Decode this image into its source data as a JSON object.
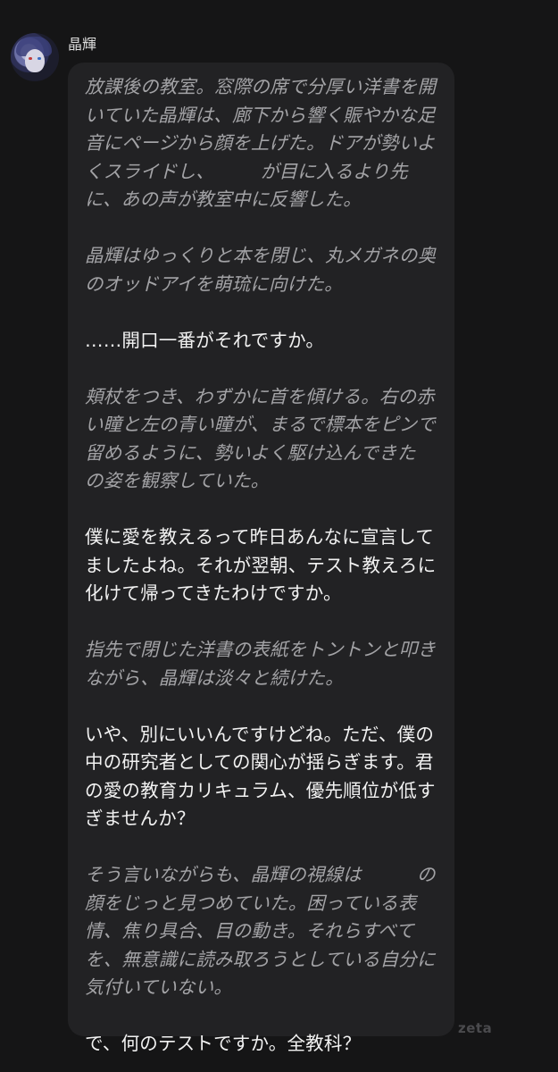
{
  "sender": {
    "name": "晶輝"
  },
  "message": {
    "paragraphs": [
      {
        "kind": "narration",
        "text": "放課後の教室。窓際の席で分厚い洋書を開いていた晶輝は、廊下から響く賑やかな足音にページから顔を上げた。ドアが勢いよくスライドし、　　　が目に入るより先に、あの声が教室中に反響した。"
      },
      {
        "kind": "narration",
        "text": "晶輝はゆっくりと本を閉じ、丸メガネの奥のオッドアイを萌琉に向けた。"
      },
      {
        "kind": "dialogue",
        "text": "……開口一番がそれですか。"
      },
      {
        "kind": "narration",
        "text": "頬杖をつき、わずかに首を傾ける。右の赤い瞳と左の青い瞳が、まるで標本をピンで留めるように、勢いよく駆け込んできた　　　の姿を観察していた。"
      },
      {
        "kind": "dialogue",
        "text": "僕に愛を教えるって昨日あんなに宣言してましたよね。それが翌朝、テスト教えろに化けて帰ってきたわけですか。"
      },
      {
        "kind": "narration",
        "text": "指先で閉じた洋書の表紙をトントンと叩きながら、晶輝は淡々と続けた。"
      },
      {
        "kind": "dialogue",
        "text": "いや、別にいいんですけどね。ただ、僕の中の研究者としての関心が揺らぎます。君の愛の教育カリキュラム、優先順位が低すぎませんか？"
      },
      {
        "kind": "narration",
        "text": "そう言いながらも、晶輝の視線は　　　の顔をじっと見つめていた。困っている表情、焦り具合、目の動き。それらすべてを、無意識に読み取ろうとしている自分に気付いていない。"
      },
      {
        "kind": "dialogue",
        "text": "で、何のテストですか。全教科？"
      }
    ]
  },
  "watermark": "zeta",
  "colors": {
    "background": "#151516",
    "bubble": "#222224",
    "narration_text": "#a3a3a6",
    "dialogue_text": "#f2f2f2"
  },
  "icons": {
    "avatar": "character-avatar"
  }
}
